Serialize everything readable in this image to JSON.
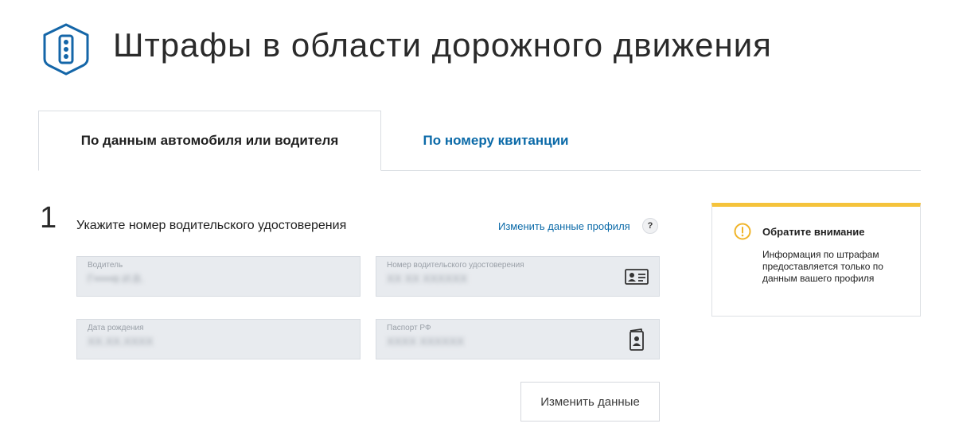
{
  "header": {
    "title": "Штрафы в области дорожного движения",
    "logo_icon": "traffic-light-icon",
    "brand_color": "#1466a8"
  },
  "tabs": [
    {
      "label": "По данным автомобиля или водителя",
      "active": true
    },
    {
      "label": "По номеру квитанции",
      "active": false
    }
  ],
  "step": {
    "number": "1",
    "title": "Укажите номер водительского удостоверения",
    "edit_link": "Изменить данные профиля",
    "help_label": "?"
  },
  "fields": {
    "driver": {
      "label": "Водитель",
      "value": "Г•••••в И.В."
    },
    "license": {
      "label": "Номер водительского удостоверения",
      "value": "ХХ ХХ ХХХХХХ",
      "icon": "id-card-icon"
    },
    "birth_date": {
      "label": "Дата рождения",
      "value": "ХХ.ХХ.ХХХХ"
    },
    "passport": {
      "label": "Паспорт РФ",
      "value": "ХХХХ ХХХХХХ",
      "icon": "passport-icon"
    }
  },
  "change_button": "Изменить данные",
  "notice": {
    "icon": "warning-icon",
    "title": "Обратите внимание",
    "text": "Информация по штрафам предоставляется только по данным вашего профиля",
    "accent_color": "#f5c33b"
  },
  "colors": {
    "link": "#0b6aa8",
    "field_bg": "#e8ebef"
  }
}
